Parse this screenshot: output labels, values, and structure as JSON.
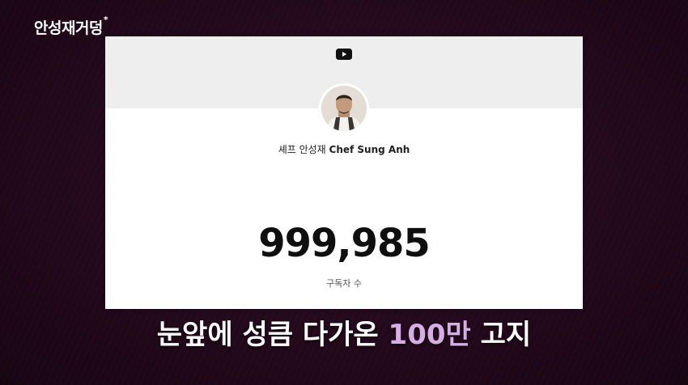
{
  "channel_logo": {
    "text": "안성재거덩",
    "star": "*"
  },
  "card": {
    "banner_icon": "youtube-play-icon",
    "channel_name_ko": "셰프 안성재",
    "channel_name_en": "Chef Sung Anh",
    "subscriber_count": "999,985",
    "subscriber_label": "구독자 수"
  },
  "caption": {
    "text_before": "눈앞에 성큼 다가온 ",
    "highlight": "100만",
    "text_after": " 고지"
  },
  "colors": {
    "background": "#24091c",
    "card": "#ffffff",
    "banner": "#eeeeee",
    "caption_text": "#ffffff",
    "caption_highlight": "#d6aee6"
  }
}
